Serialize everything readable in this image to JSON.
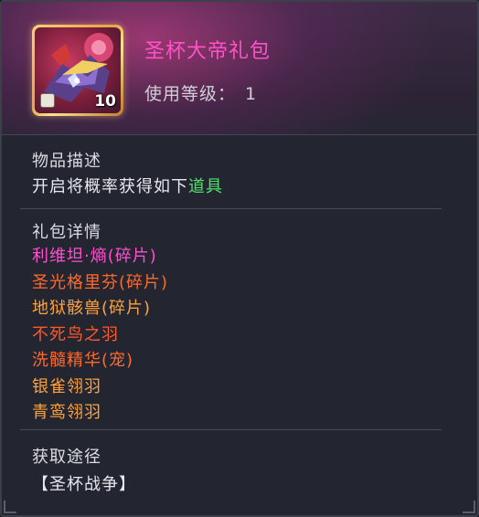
{
  "item": {
    "name": "圣杯大帝礼包",
    "count": "10",
    "level_label": "使用等级：",
    "level_value": "1"
  },
  "description": {
    "title": "物品描述",
    "text": "开启将概率获得如下",
    "highlight": "道具"
  },
  "details": {
    "title": "礼包详情",
    "items": [
      {
        "label": "利维坦·熵(碎片)",
        "color": "#ff4fcf"
      },
      {
        "label": "圣光格里芬(碎片)",
        "color": "#ff6a2c"
      },
      {
        "label": "地狱骸兽(碎片)",
        "color": "#ffa23c"
      },
      {
        "label": "不死鸟之羽",
        "color": "#ff5a2a"
      },
      {
        "label": "洗髓精华(宠)",
        "color": "#ff6a2c"
      },
      {
        "label": "银雀翎羽",
        "color": "#ffa23c"
      },
      {
        "label": "青鸾翎羽",
        "color": "#ffa23c"
      }
    ]
  },
  "source": {
    "title": "获取途径",
    "value": "【圣杯战争】"
  },
  "colors": {
    "name": "#ff52c8",
    "highlight": "#52e06a"
  }
}
